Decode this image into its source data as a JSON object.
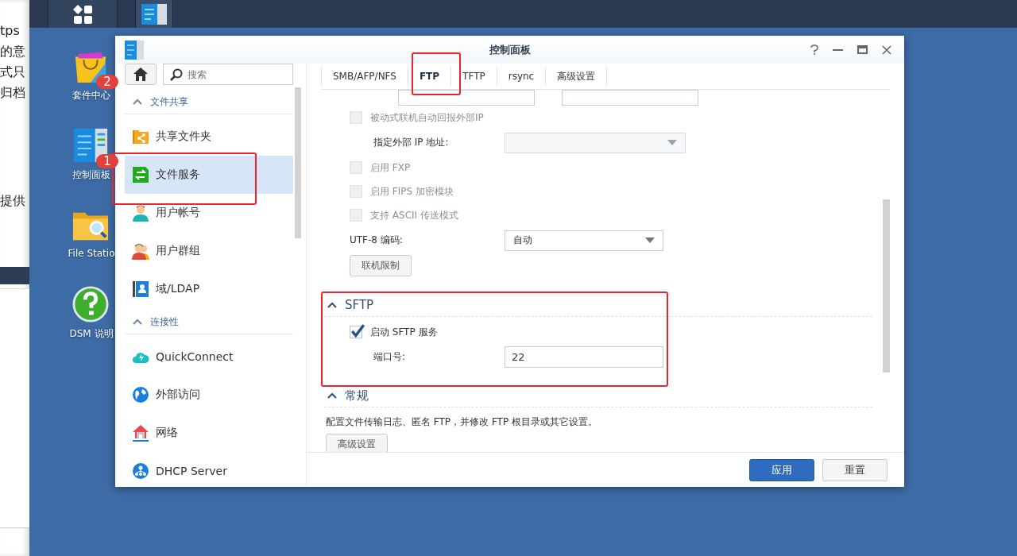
{
  "background_page": {
    "text_lines": [
      "tps",
      "的意",
      "式只",
      "归档",
      "提供"
    ]
  },
  "desktop_icons": [
    {
      "kind": "package",
      "label": "套件中心",
      "badge": "2"
    },
    {
      "kind": "control-panel",
      "label": "控制面板",
      "badge": "1"
    },
    {
      "kind": "folder-search",
      "label": "File Statio"
    },
    {
      "kind": "help",
      "label": "DSM 说明"
    }
  ],
  "window": {
    "title": "控制面板",
    "search": {
      "placeholder": "搜索"
    },
    "sidebar": {
      "sections": [
        {
          "title": "文件共享",
          "expanded": true,
          "items": [
            {
              "kind": "shared-folder",
              "label": "共享文件夹",
              "selected": false
            },
            {
              "kind": "file-services",
              "label": "文件服务",
              "selected": true
            },
            {
              "kind": "user",
              "label": "用户帐号",
              "selected": false
            },
            {
              "kind": "group",
              "label": "用户群组",
              "selected": false
            },
            {
              "kind": "ldap",
              "label": "域/LDAP",
              "selected": false
            }
          ]
        },
        {
          "title": "连接性",
          "expanded": true,
          "items": [
            {
              "kind": "quickconnect",
              "label": "QuickConnect",
              "selected": false
            },
            {
              "kind": "globe",
              "label": "外部访问",
              "selected": false
            },
            {
              "kind": "network",
              "label": "网络",
              "selected": false
            },
            {
              "kind": "dhcp",
              "label": "DHCP Server",
              "selected": false
            }
          ]
        }
      ]
    },
    "tabs": [
      {
        "label": "SMB/AFP/NFS",
        "selected": false
      },
      {
        "label": "FTP",
        "selected": true
      },
      {
        "label": "TFTP",
        "selected": false
      },
      {
        "label": "rsync",
        "selected": false
      },
      {
        "label": "高级设置",
        "selected": false
      }
    ],
    "rows": [
      {
        "kind": "range-fields"
      },
      {
        "kind": "checkbox",
        "label": "被动式联机自动回报外部IP",
        "checked": false,
        "disabled": true,
        "children": [
          {
            "kind": "select",
            "label": "指定外部 IP 地址:",
            "disabled": true
          }
        ]
      },
      {
        "kind": "checkbox",
        "label": "启用 FXP",
        "checked": false,
        "disabled": true
      },
      {
        "kind": "checkbox",
        "label": "启用 FIPS 加密模块",
        "checked": false,
        "disabled": true
      },
      {
        "kind": "checkbox",
        "label": "支持 ASCII 传送模式",
        "checked": false,
        "disabled": true
      },
      {
        "kind": "select",
        "label": "UTF-8 编码:",
        "value": "自动",
        "disabled": false
      },
      {
        "kind": "button",
        "label": "联机限制"
      },
      {
        "kind": "section",
        "title": "SFTP",
        "expanded": true
      },
      {
        "kind": "checkbox",
        "label": "启动 SFTP 服务",
        "checked": true,
        "disabled": false,
        "children": [
          {
            "kind": "field",
            "label": "端口号:",
            "value": "22"
          }
        ]
      },
      {
        "kind": "section",
        "title": "常规",
        "expanded": true
      },
      {
        "kind": "text",
        "text": "配置文件传输日志、匿名 FTP，并修改 FTP 根目录或其它设置。"
      },
      {
        "kind": "button",
        "label": "高级设置"
      }
    ],
    "buttons": [
      {
        "kind": "primary",
        "label": "应用"
      },
      {
        "kind": "secondary",
        "label": "重置"
      }
    ]
  }
}
